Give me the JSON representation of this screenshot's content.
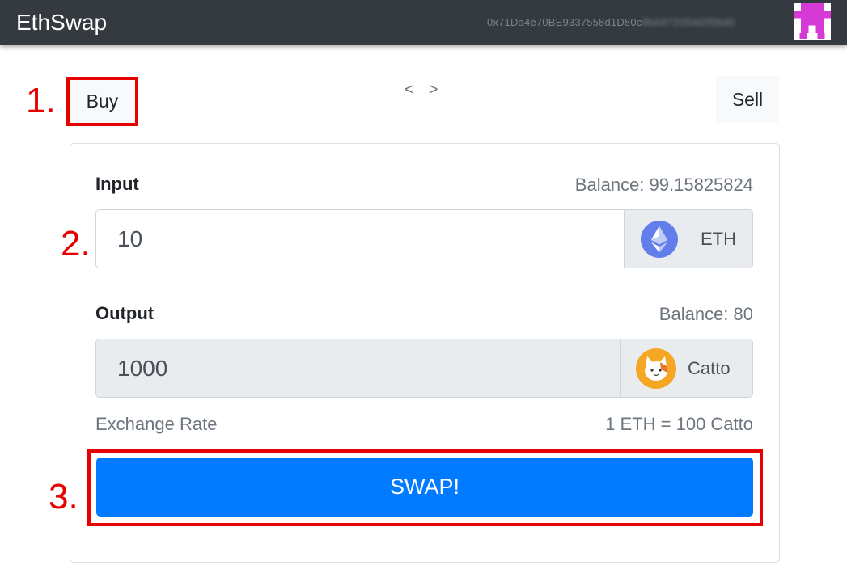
{
  "navbar": {
    "brand": "EthSwap",
    "account_visible": "0x71Da4e70BE9337558d1D80c",
    "account_blurred": "8bA9720DADf0bd0"
  },
  "mode": {
    "buy_label": "Buy",
    "sell_label": "Sell",
    "prev": "<",
    "next": ">"
  },
  "input": {
    "label": "Input",
    "balance": "Balance: 99.15825824",
    "value": "10",
    "token": "ETH"
  },
  "output": {
    "label": "Output",
    "balance": "Balance: 80",
    "value": "1000",
    "token": "Catto"
  },
  "rate": {
    "label": "Exchange Rate",
    "value": "1 ETH = 100 Catto"
  },
  "swap_label": "SWAP!",
  "annotations": {
    "step1": "1.",
    "step2": "2.",
    "step3": "3.",
    "color": "#e60000"
  },
  "colors": {
    "navbar": "#343a40",
    "primary": "#007bff",
    "eth": "#627eea",
    "catto": "#f5a623"
  }
}
